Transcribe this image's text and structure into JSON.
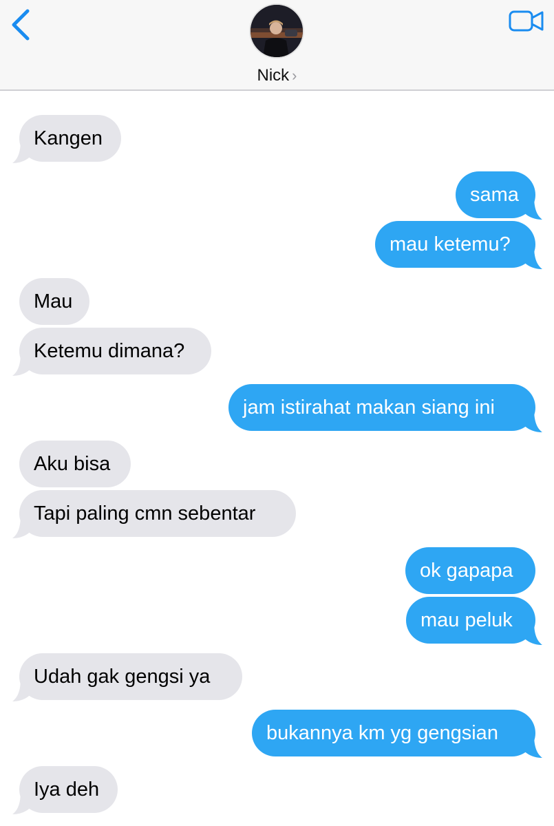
{
  "header": {
    "contact_name": "Nick",
    "chevron": "›",
    "icons": {
      "back": "chevron-left-icon",
      "video": "video-camera-icon"
    },
    "accent_color": "#1a8cf0"
  },
  "colors": {
    "incoming_bubble": "#e5e5ea",
    "outgoing_bubble": "#2ea6f3"
  },
  "messages": [
    {
      "direction": "incoming",
      "text": "Kangen"
    },
    {
      "direction": "outgoing",
      "text": "sama"
    },
    {
      "direction": "outgoing",
      "text": "mau ketemu?"
    },
    {
      "direction": "incoming",
      "text": "Mau"
    },
    {
      "direction": "incoming",
      "text": "Ketemu dimana?"
    },
    {
      "direction": "outgoing",
      "text": "jam istirahat makan siang ini"
    },
    {
      "direction": "incoming",
      "text": "Aku bisa"
    },
    {
      "direction": "incoming",
      "text": "Tapi paling cmn sebentar"
    },
    {
      "direction": "outgoing",
      "text": "ok gapapa"
    },
    {
      "direction": "outgoing",
      "text": "mau peluk"
    },
    {
      "direction": "incoming",
      "text": "Udah gak gengsi ya"
    },
    {
      "direction": "outgoing",
      "text": "bukannya km yg gengsian"
    },
    {
      "direction": "incoming",
      "text": "Iya deh"
    }
  ]
}
